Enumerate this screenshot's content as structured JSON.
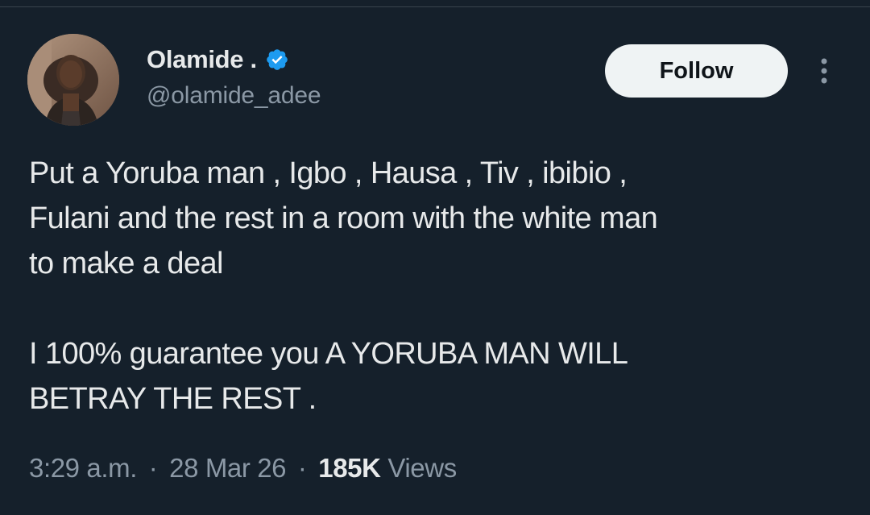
{
  "author": {
    "display_name": "Olamide .",
    "handle": "@olamide_adee",
    "verified": true,
    "avatar_icon": "profile-photo"
  },
  "actions": {
    "follow_label": "Follow",
    "more_icon": "more-vertical-icon"
  },
  "tweet": {
    "lines_p1": [
      "Put a Yoruba man , Igbo , Hausa , Tiv , ibibio ,",
      "Fulani and the rest in a room with the white man",
      "to make a deal"
    ],
    "lines_p2": [
      "I 100% guarantee you A YORUBA MAN WILL",
      "BETRAY THE REST ."
    ]
  },
  "meta": {
    "time": "3:29 a.m.",
    "date": "28 Mar 26",
    "views_count": "185K",
    "views_label": "Views",
    "separator": "·"
  },
  "colors": {
    "background": "#15202b",
    "text_primary": "#e7e9ea",
    "text_secondary": "#8b98a5",
    "verified_blue": "#1d9bf0",
    "follow_bg": "#eff3f4"
  }
}
